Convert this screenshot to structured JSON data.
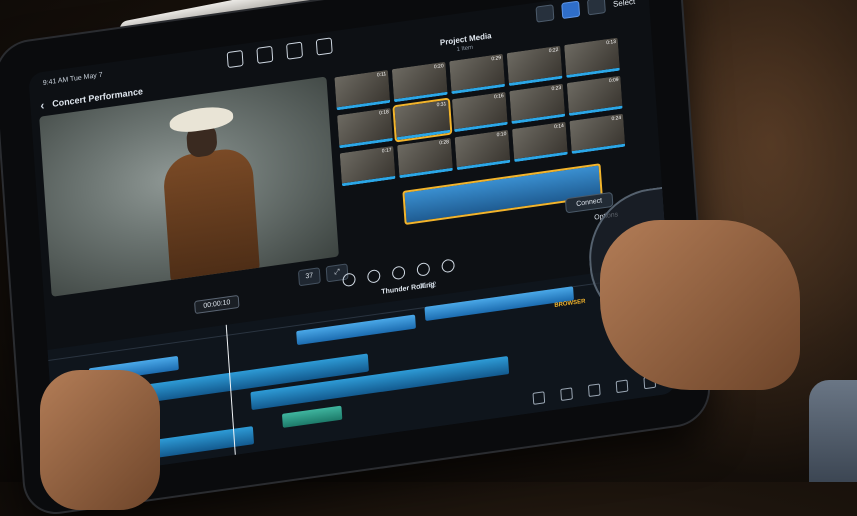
{
  "screen": {
    "status_text": "9:41 AM  Tue May 7",
    "back_label": "Concert Performance",
    "select_label": "Select",
    "browser_title": "Project Media",
    "browser_subtitle": "1 Item",
    "connect_label": "Connect",
    "options_label": "Options",
    "viewer_zoom": "37",
    "viewer_timecode": "00:00:10",
    "project_name": "Thunder Rolling",
    "project_duration": "01:52",
    "timeline_browser_label": "BROWSER"
  },
  "thumbnails": [
    {
      "badge": "0:11"
    },
    {
      "badge": "0:20"
    },
    {
      "badge": "0:29"
    },
    {
      "badge": "0:22"
    },
    {
      "badge": "0:13"
    },
    {
      "badge": "0:18"
    },
    {
      "badge": "0:31"
    },
    {
      "badge": "0:16"
    },
    {
      "badge": "0:23"
    },
    {
      "badge": "0:09"
    },
    {
      "badge": "0:17"
    },
    {
      "badge": "0:28"
    },
    {
      "badge": "0:10"
    },
    {
      "badge": "0:14"
    },
    {
      "badge": "0:24"
    }
  ],
  "colors": {
    "accent_blue": "#2ba7e8",
    "selection_yellow": "#f2b42c",
    "clip_green": "#3fb59f"
  },
  "icons": [
    "back-chevron-icon",
    "camera-icon",
    "microphone-icon",
    "share-icon",
    "play-icon",
    "scissors-icon",
    "jog-wheel-icon",
    "trash-icon"
  ]
}
